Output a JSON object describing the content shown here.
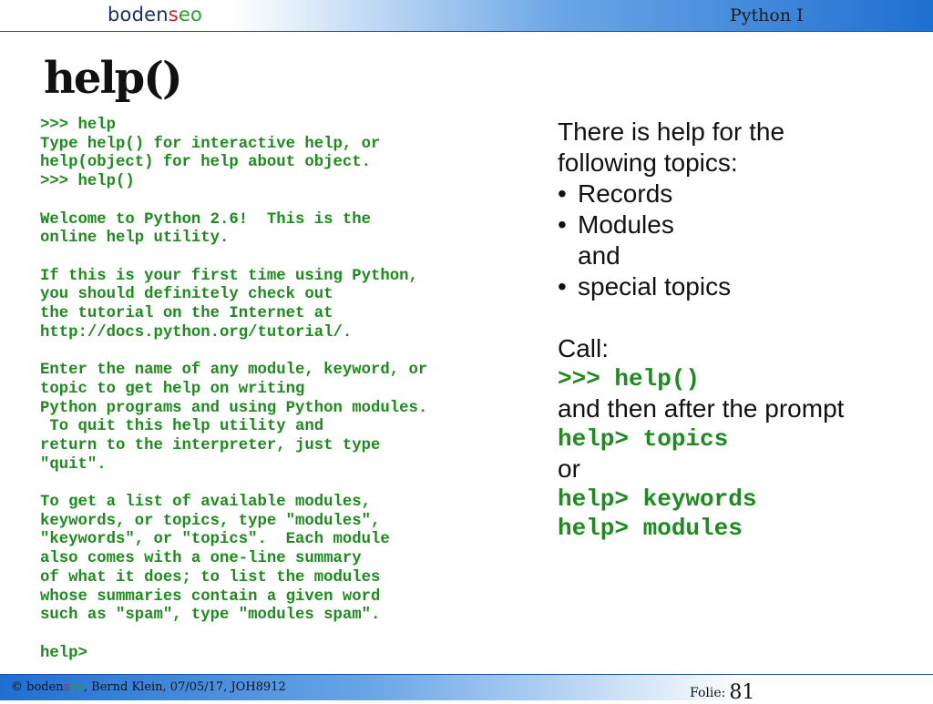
{
  "header": {
    "logo": {
      "part1": "boden",
      "part2": "s",
      "part3": "eo"
    },
    "course": "Python I"
  },
  "title": "help()",
  "code_lines": [
    ">>> help",
    "Type help() for interactive help, or",
    "help(object) for help about object.",
    ">>> help()",
    "",
    "Welcome to Python 2.6!  This is the",
    "online help utility.",
    "",
    "If this is your first time using Python,",
    "you should definitely check out",
    "the tutorial on the Internet at",
    "http://docs.python.org/tutorial/.",
    "",
    "Enter the name of any module, keyword, or",
    "topic to get help on writing",
    "Python programs and using Python modules.",
    " To quit this help utility and",
    "return to the interpreter, just type",
    "\"quit\".",
    "",
    "To get a list of available modules,",
    "keywords, or topics, type \"modules\",",
    "\"keywords\", or \"topics\".  Each module",
    "also comes with a one-line summary",
    "of what it does; to list the modules",
    "whose summaries contain a given word",
    "such as \"spam\", type \"modules spam\".",
    "",
    "help>"
  ],
  "right": {
    "intro_line1": "There is help for the",
    "intro_line2": "following topics:",
    "bullet1": "Records",
    "bullet2": "Modules",
    "and": "and",
    "bullet3": "special topics",
    "call": "Call:",
    "cmd_help": ">>> help()",
    "after": "and then after the prompt",
    "cmd_topics": "help> topics",
    "or": "or",
    "cmd_keywords": "help> keywords",
    "cmd_modules": "help> modules"
  },
  "footer": {
    "copyright": "©",
    "logo": {
      "part1": "boden",
      "part2": "s",
      "part3": "eo"
    },
    "text": ", Bernd Klein, 07/05/17, JOH8912",
    "folie_label": "Folie:",
    "folie_number": "81"
  }
}
